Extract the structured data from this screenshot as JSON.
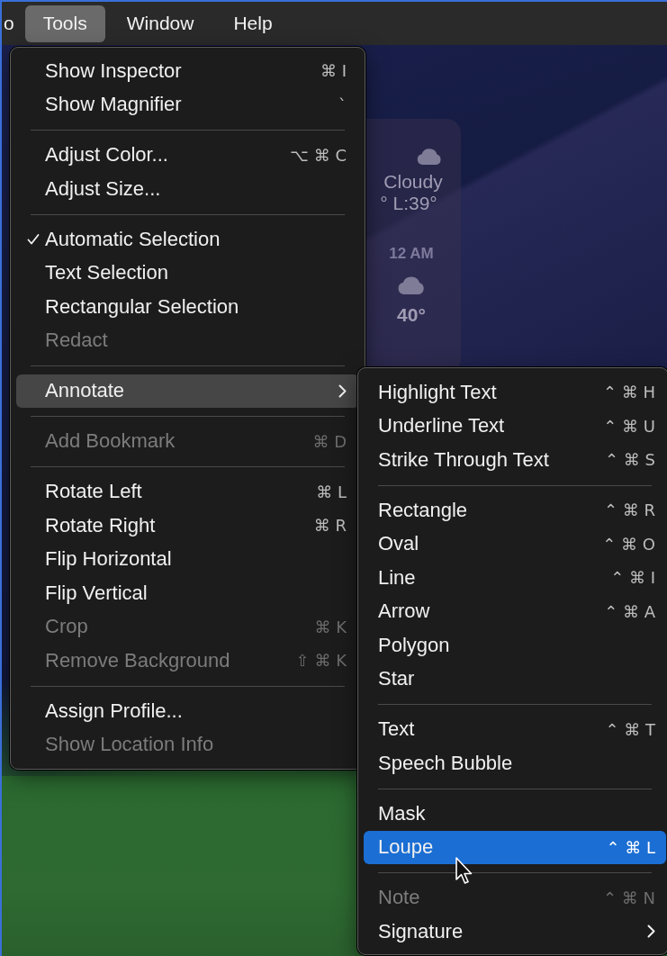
{
  "menu_bar": [
    {
      "label": "o",
      "selected": false
    },
    {
      "label": "Tools",
      "selected": true
    },
    {
      "label": "Window",
      "selected": false
    },
    {
      "label": "Help",
      "selected": false
    }
  ],
  "weather_widget": {
    "condition": "Cloudy",
    "range": "° L:39°",
    "hour_label": "12 AM",
    "hour_temp": "40°"
  },
  "tools_menu": [
    {
      "kind": "item",
      "label": "Show Inspector",
      "shortcut": "⌘ I",
      "disabled": false,
      "checked": false,
      "selected": false,
      "submenu": false
    },
    {
      "kind": "item",
      "label": "Show Magnifier",
      "shortcut": "`",
      "disabled": false,
      "checked": false,
      "selected": false,
      "submenu": false
    },
    {
      "kind": "separator"
    },
    {
      "kind": "item",
      "label": "Adjust Color...",
      "shortcut": "⌥ ⌘ C",
      "disabled": false,
      "checked": false,
      "selected": false,
      "submenu": false
    },
    {
      "kind": "item",
      "label": "Adjust Size...",
      "disabled": false,
      "checked": false,
      "selected": false,
      "submenu": false
    },
    {
      "kind": "separator"
    },
    {
      "kind": "item",
      "label": "Automatic Selection",
      "disabled": false,
      "checked": true,
      "selected": false,
      "submenu": false
    },
    {
      "kind": "item",
      "label": "Text Selection",
      "disabled": false,
      "checked": false,
      "selected": false,
      "submenu": false
    },
    {
      "kind": "item",
      "label": "Rectangular Selection",
      "disabled": false,
      "checked": false,
      "selected": false,
      "submenu": false
    },
    {
      "kind": "item",
      "label": "Redact",
      "disabled": true,
      "checked": false,
      "selected": false,
      "submenu": false
    },
    {
      "kind": "separator"
    },
    {
      "kind": "item",
      "label": "Annotate",
      "disabled": false,
      "checked": false,
      "selected": true,
      "submenu": true
    },
    {
      "kind": "separator"
    },
    {
      "kind": "item",
      "label": "Add Bookmark",
      "shortcut": "⌘ D",
      "disabled": true,
      "checked": false,
      "selected": false,
      "submenu": false
    },
    {
      "kind": "separator"
    },
    {
      "kind": "item",
      "label": "Rotate Left",
      "shortcut": "⌘ L",
      "disabled": false,
      "checked": false,
      "selected": false,
      "submenu": false
    },
    {
      "kind": "item",
      "label": "Rotate Right",
      "shortcut": "⌘ R",
      "disabled": false,
      "checked": false,
      "selected": false,
      "submenu": false
    },
    {
      "kind": "item",
      "label": "Flip Horizontal",
      "disabled": false,
      "checked": false,
      "selected": false,
      "submenu": false
    },
    {
      "kind": "item",
      "label": "Flip Vertical",
      "disabled": false,
      "checked": false,
      "selected": false,
      "submenu": false
    },
    {
      "kind": "item",
      "label": "Crop",
      "shortcut": "⌘ K",
      "disabled": true,
      "checked": false,
      "selected": false,
      "submenu": false
    },
    {
      "kind": "item",
      "label": "Remove Background",
      "shortcut": "⇧ ⌘ K",
      "disabled": true,
      "checked": false,
      "selected": false,
      "submenu": false
    },
    {
      "kind": "separator"
    },
    {
      "kind": "item",
      "label": "Assign Profile...",
      "disabled": false,
      "checked": false,
      "selected": false,
      "submenu": false
    },
    {
      "kind": "item",
      "label": "Show Location Info",
      "disabled": true,
      "checked": false,
      "selected": false,
      "submenu": false
    }
  ],
  "annotate_submenu": [
    {
      "kind": "item",
      "label": "Highlight Text",
      "shortcut": "⌃ ⌘ H",
      "disabled": false,
      "selected": false,
      "submenu": false
    },
    {
      "kind": "item",
      "label": "Underline Text",
      "shortcut": "⌃ ⌘ U",
      "disabled": false,
      "selected": false,
      "submenu": false
    },
    {
      "kind": "item",
      "label": "Strike Through Text",
      "shortcut": "⌃ ⌘ S",
      "disabled": false,
      "selected": false,
      "submenu": false
    },
    {
      "kind": "separator"
    },
    {
      "kind": "item",
      "label": "Rectangle",
      "shortcut": "⌃ ⌘ R",
      "disabled": false,
      "selected": false,
      "submenu": false
    },
    {
      "kind": "item",
      "label": "Oval",
      "shortcut": "⌃ ⌘ O",
      "disabled": false,
      "selected": false,
      "submenu": false
    },
    {
      "kind": "item",
      "label": "Line",
      "shortcut": "⌃ ⌘ I",
      "disabled": false,
      "selected": false,
      "submenu": false
    },
    {
      "kind": "item",
      "label": "Arrow",
      "shortcut": "⌃ ⌘ A",
      "disabled": false,
      "selected": false,
      "submenu": false
    },
    {
      "kind": "item",
      "label": "Polygon",
      "disabled": false,
      "selected": false,
      "submenu": false
    },
    {
      "kind": "item",
      "label": "Star",
      "disabled": false,
      "selected": false,
      "submenu": false
    },
    {
      "kind": "separator"
    },
    {
      "kind": "item",
      "label": "Text",
      "shortcut": "⌃ ⌘ T",
      "disabled": false,
      "selected": false,
      "submenu": false
    },
    {
      "kind": "item",
      "label": "Speech Bubble",
      "disabled": false,
      "selected": false,
      "submenu": false
    },
    {
      "kind": "separator"
    },
    {
      "kind": "item",
      "label": "Mask",
      "disabled": false,
      "selected": false,
      "submenu": false
    },
    {
      "kind": "item",
      "label": "Loupe",
      "shortcut": "⌃ ⌘ L",
      "disabled": false,
      "selected": true,
      "submenu": false
    },
    {
      "kind": "separator"
    },
    {
      "kind": "item",
      "label": "Note",
      "shortcut": "⌃ ⌘ N",
      "disabled": true,
      "selected": false,
      "submenu": false
    },
    {
      "kind": "item",
      "label": "Signature",
      "disabled": false,
      "selected": false,
      "submenu": true
    }
  ]
}
